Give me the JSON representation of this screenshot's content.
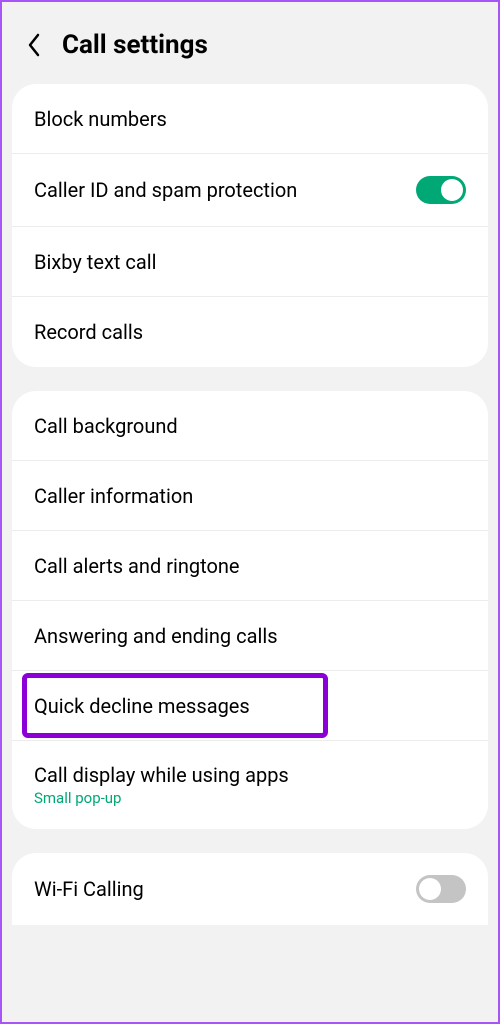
{
  "header": {
    "title": "Call settings"
  },
  "sections": [
    {
      "items": [
        {
          "label": "Block numbers"
        },
        {
          "label": "Caller ID and spam protection",
          "toggle": true,
          "toggleOn": true
        },
        {
          "label": "Bixby text call"
        },
        {
          "label": "Record calls"
        }
      ]
    },
    {
      "items": [
        {
          "label": "Call background"
        },
        {
          "label": "Caller information"
        },
        {
          "label": "Call alerts and ringtone"
        },
        {
          "label": "Answering and ending calls"
        },
        {
          "label": "Quick decline messages",
          "highlighted": true
        },
        {
          "label": "Call display while using apps",
          "sublabel": "Small pop-up"
        }
      ]
    },
    {
      "items": [
        {
          "label": "Wi-Fi Calling",
          "toggle": true,
          "toggleOn": false
        }
      ]
    }
  ]
}
